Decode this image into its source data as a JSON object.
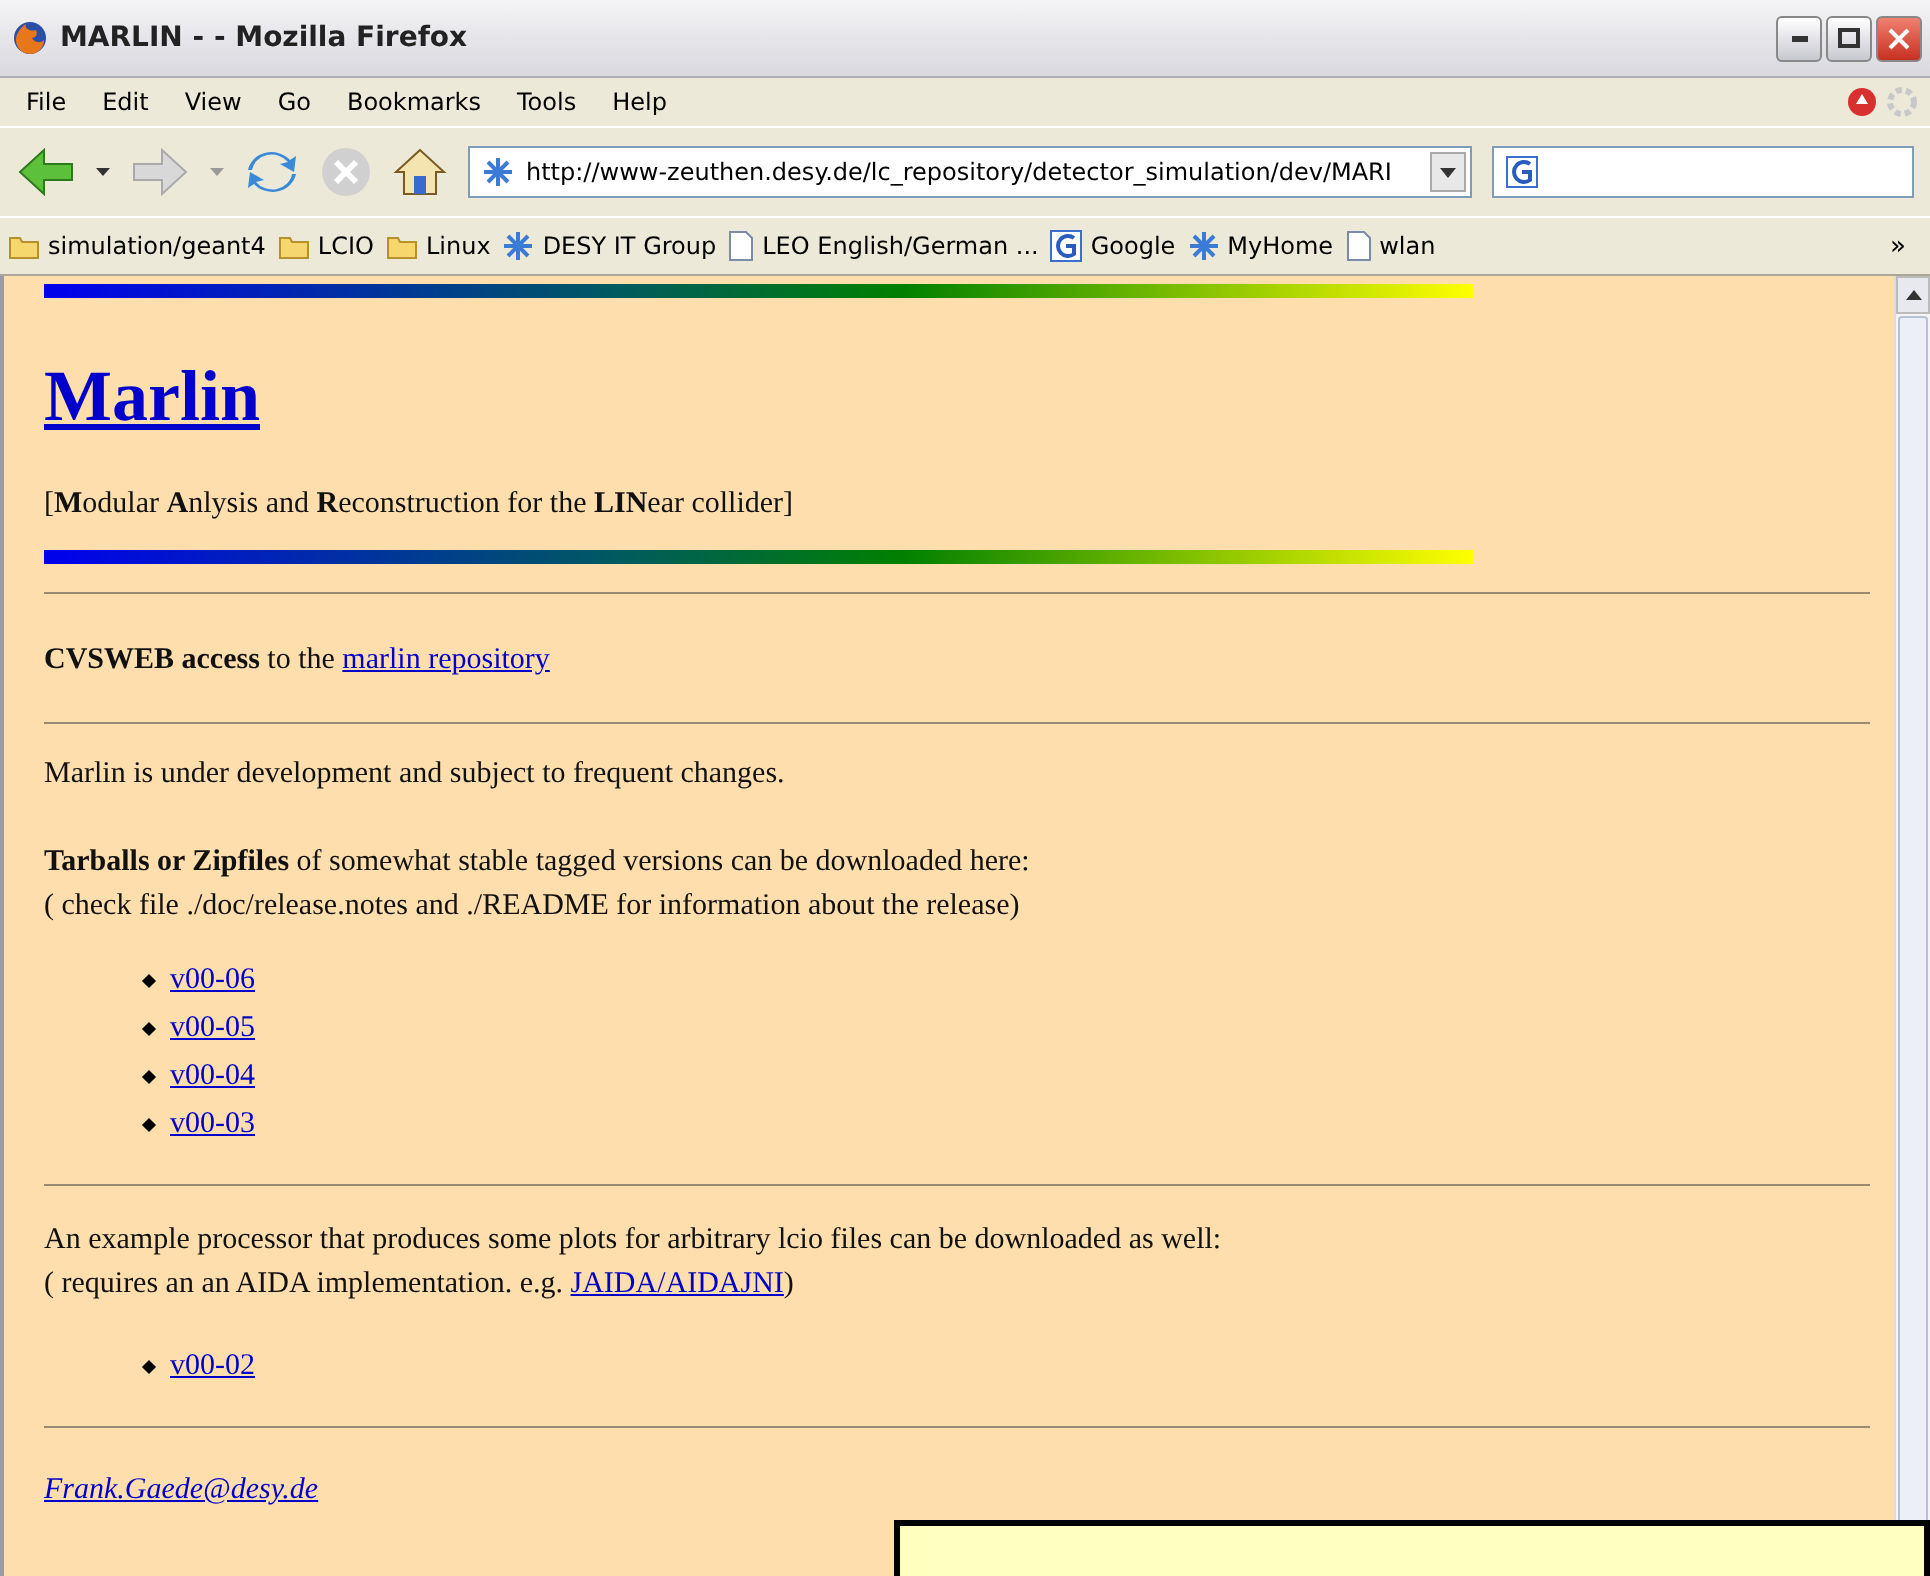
{
  "window": {
    "title": "MARLIN - - Mozilla Firefox"
  },
  "menu": [
    "File",
    "Edit",
    "View",
    "Go",
    "Bookmarks",
    "Tools",
    "Help"
  ],
  "address": {
    "url": "http://www-zeuthen.desy.de/lc_repository/detector_simulation/dev/MARI"
  },
  "bookmarks": [
    {
      "kind": "folder",
      "label": "simulation/geant4"
    },
    {
      "kind": "folder",
      "label": "LCIO"
    },
    {
      "kind": "folder",
      "label": "Linux"
    },
    {
      "kind": "network",
      "label": "DESY IT Group"
    },
    {
      "kind": "page",
      "label": "LEO English/German ..."
    },
    {
      "kind": "google",
      "label": "Google"
    },
    {
      "kind": "network",
      "label": "MyHome"
    },
    {
      "kind": "page",
      "label": "wlan"
    }
  ],
  "bookmarks_more": "»",
  "page": {
    "heading": "Marlin",
    "subtitle": "[**M**odular **A**nlysis and **R**econstruction for the **LIN**ear collider]",
    "cvsweb": {
      "text": "**CVSWEB access** to the ",
      "link": "marlin repository"
    },
    "status": "Marlin is under development and subject to frequent changes.",
    "tarballs": "**Tarballs or Zipfiles** of somewhat stable tagged versions can be downloaded here:",
    "tarballs_note": "( check file ./doc/release.notes and ./README for information about the release)",
    "versions": [
      "v00-06",
      "v00-05",
      "v00-04",
      "v00-03"
    ],
    "example": "An example processor that produces some plots for arbitrary lcio files can be downloaded as well:",
    "example_note": {
      "text": "( requires an an AIDA implementation. e.g. ",
      "link": "JAIDA/AIDAJNI",
      "after": ")"
    },
    "example_versions": [
      "v00-02"
    ],
    "email": "Frank.Gaede@desy.de"
  }
}
